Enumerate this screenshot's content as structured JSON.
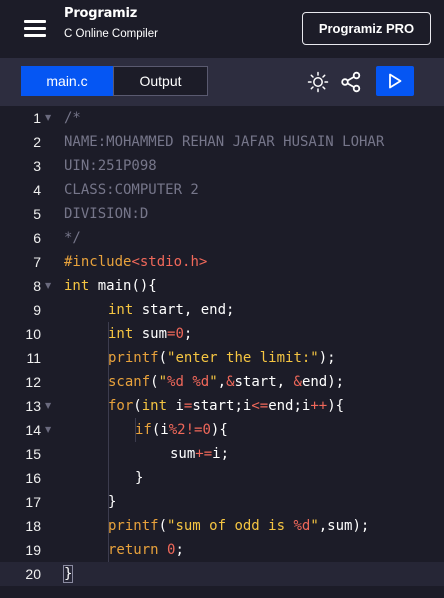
{
  "header": {
    "logo_text": "Programiz",
    "subtitle": "C Online Compiler",
    "pro_button": "Programiz PRO"
  },
  "toolbar": {
    "tabs": [
      {
        "label": "main.c",
        "active": true
      },
      {
        "label": "Output",
        "active": false
      }
    ],
    "icons": [
      "theme-toggle-icon",
      "share-icon",
      "run-icon"
    ]
  },
  "colors": {
    "accent": "#0556f3",
    "background": "#1c1c28",
    "toolbar": "#2d2d3f",
    "comment": "#76768a",
    "keyword": "#f5c542",
    "number": "#f0685a"
  },
  "editor": {
    "lines": [
      {
        "n": "1",
        "segments": [
          {
            "t": "/*",
            "c": "com"
          }
        ]
      },
      {
        "n": "2",
        "segments": [
          {
            "t": "NAME:MOHAMMED REHAN JAFAR HUSAIN LOHAR",
            "c": "com"
          }
        ]
      },
      {
        "n": "3",
        "segments": [
          {
            "t": "UIN:251P098",
            "c": "com"
          }
        ]
      },
      {
        "n": "4",
        "segments": [
          {
            "t": "CLASS:COMPUTER 2",
            "c": "com"
          }
        ]
      },
      {
        "n": "5",
        "segments": [
          {
            "t": "DIVISION:D",
            "c": "com"
          }
        ]
      },
      {
        "n": "6",
        "segments": [
          {
            "t": "*/",
            "c": "com"
          }
        ]
      },
      {
        "n": "7",
        "segments": [
          {
            "t": "#include",
            "c": "kw2"
          },
          {
            "t": "<stdio.h>",
            "c": "op"
          }
        ]
      },
      {
        "n": "8",
        "segments": [
          {
            "t": "int",
            "c": "kw"
          },
          {
            "t": " main(){",
            "c": "txt"
          }
        ]
      },
      {
        "n": "9",
        "segments": [
          {
            "t": "int",
            "c": "kw"
          },
          {
            "t": " start, end;",
            "c": "txt"
          }
        ]
      },
      {
        "n": "10",
        "segments": [
          {
            "t": "int",
            "c": "kw"
          },
          {
            "t": " sum",
            "c": "txt"
          },
          {
            "t": "=",
            "c": "op"
          },
          {
            "t": "0",
            "c": "num"
          },
          {
            "t": ";",
            "c": "txt"
          }
        ]
      },
      {
        "n": "11",
        "segments": [
          {
            "t": "printf",
            "c": "kw2"
          },
          {
            "t": "(",
            "c": "txt"
          },
          {
            "t": "\"enter the limit:\"",
            "c": "str"
          },
          {
            "t": ");",
            "c": "txt"
          }
        ]
      },
      {
        "n": "12",
        "segments": [
          {
            "t": "scanf",
            "c": "kw2"
          },
          {
            "t": "(",
            "c": "txt"
          },
          {
            "t": "\"",
            "c": "str"
          },
          {
            "t": "%d %d",
            "c": "fmt"
          },
          {
            "t": "\"",
            "c": "str"
          },
          {
            "t": ",",
            "c": "txt"
          },
          {
            "t": "&",
            "c": "op"
          },
          {
            "t": "start, ",
            "c": "txt"
          },
          {
            "t": "&",
            "c": "op"
          },
          {
            "t": "end);",
            "c": "txt"
          }
        ]
      },
      {
        "n": "13",
        "segments": [
          {
            "t": "for",
            "c": "kw2"
          },
          {
            "t": "(",
            "c": "txt"
          },
          {
            "t": "int",
            "c": "kw"
          },
          {
            "t": " i",
            "c": "txt"
          },
          {
            "t": "=",
            "c": "op"
          },
          {
            "t": "start;i",
            "c": "txt"
          },
          {
            "t": "<=",
            "c": "op"
          },
          {
            "t": "end;i",
            "c": "txt"
          },
          {
            "t": "++",
            "c": "op"
          },
          {
            "t": "){",
            "c": "txt"
          }
        ]
      },
      {
        "n": "14",
        "segments": [
          {
            "t": "if",
            "c": "kw2"
          },
          {
            "t": "(i",
            "c": "txt"
          },
          {
            "t": "%",
            "c": "op"
          },
          {
            "t": "2",
            "c": "num"
          },
          {
            "t": "!=",
            "c": "op"
          },
          {
            "t": "0",
            "c": "num"
          },
          {
            "t": "){",
            "c": "txt"
          }
        ]
      },
      {
        "n": "15",
        "segments": [
          {
            "t": "sum",
            "c": "txt"
          },
          {
            "t": "+=",
            "c": "op"
          },
          {
            "t": "i;",
            "c": "txt"
          }
        ]
      },
      {
        "n": "16",
        "segments": [
          {
            "t": "}",
            "c": "txt"
          }
        ]
      },
      {
        "n": "17",
        "segments": [
          {
            "t": "}",
            "c": "txt"
          }
        ]
      },
      {
        "n": "18",
        "segments": [
          {
            "t": "printf",
            "c": "kw2"
          },
          {
            "t": "(",
            "c": "txt"
          },
          {
            "t": "\"sum of odd is ",
            "c": "str"
          },
          {
            "t": "%d",
            "c": "fmt"
          },
          {
            "t": "\"",
            "c": "str"
          },
          {
            "t": ",sum);",
            "c": "txt"
          }
        ]
      },
      {
        "n": "19",
        "segments": [
          {
            "t": "return",
            "c": "kw2"
          },
          {
            "t": " ",
            "c": "txt"
          },
          {
            "t": "0",
            "c": "num"
          },
          {
            "t": ";",
            "c": "txt"
          }
        ]
      },
      {
        "n": "20",
        "segments": [
          {
            "t": "}",
            "c": "txt"
          }
        ]
      }
    ]
  }
}
